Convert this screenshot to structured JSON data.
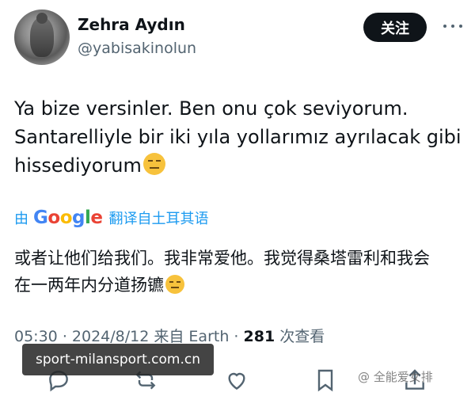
{
  "user": {
    "display_name": "Zehra Aydın",
    "handle": "@yabisakinolun"
  },
  "header": {
    "follow_label": "关注",
    "more_icon": "more-horizontal-icon"
  },
  "tweet": {
    "lines": [
      "Ya bize versinler. Ben onu çok seviyorum.",
      "Santarelliyle bir iki yıla yollarımız ayrılacak gibi",
      "hissediyorum"
    ],
    "emoji": "expressionless-face-emoji"
  },
  "translation": {
    "by_label": "由",
    "provider_letters": [
      "G",
      "o",
      "o",
      "g",
      "l",
      "e"
    ],
    "action_label": "翻译自土耳其语",
    "lines": [
      "或者让他们给我们。我非常爱他。我觉得桑塔雷利和我会",
      "在一两年内分道扬镳"
    ]
  },
  "meta": {
    "time": "05:30",
    "separator": "·",
    "date": "2024/8/12",
    "source": "来自 Earth",
    "views_count": "281",
    "views_label": "次查看"
  },
  "actions": [
    {
      "name": "reply-icon"
    },
    {
      "name": "retweet-icon"
    },
    {
      "name": "like-icon"
    },
    {
      "name": "bookmark-icon"
    },
    {
      "name": "share-icon"
    }
  ],
  "watermarks": {
    "left": "sport-milansport.com.cn",
    "right": "@ 全能爱女排"
  },
  "colors": {
    "link_blue": "#1d9bf0",
    "muted": "#536471",
    "text": "#0f1419",
    "button_bg": "#0f1419"
  }
}
